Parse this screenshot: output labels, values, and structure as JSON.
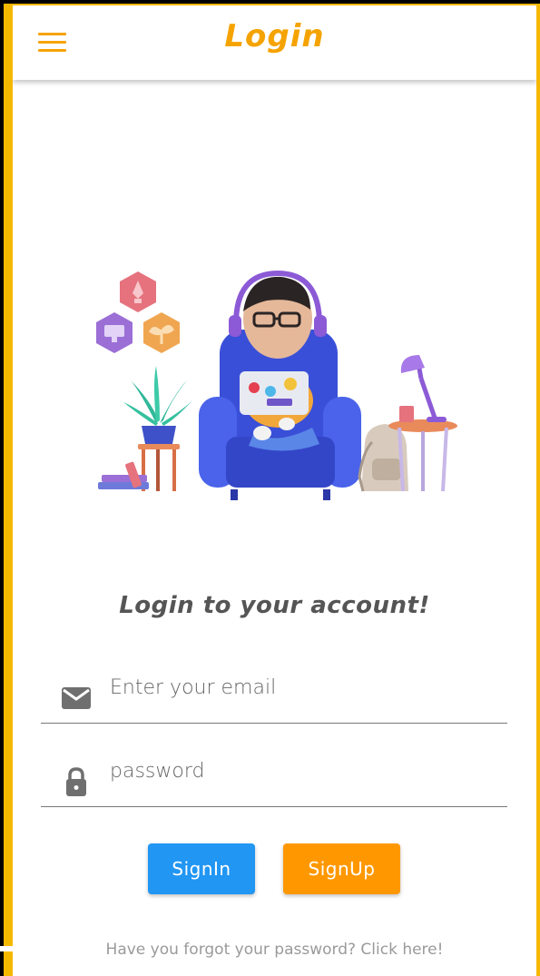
{
  "header": {
    "title": "Login",
    "menu_icon": "hamburger-menu-icon"
  },
  "main": {
    "subtitle": "Login to your account!",
    "email_field": {
      "placeholder": "Enter your email",
      "value": "",
      "icon": "envelope-icon"
    },
    "password_field": {
      "placeholder": "password",
      "value": "",
      "icon": "lock-icon"
    },
    "signin_label": "SignIn",
    "signup_label": "SignUp",
    "forgot_text": "Have you forgot your password? Click here!"
  },
  "colors": {
    "accent": "#F5A300",
    "frame": "#F5B800",
    "signin": "#2196F3",
    "signup": "#FF9800",
    "text": "#555555"
  }
}
